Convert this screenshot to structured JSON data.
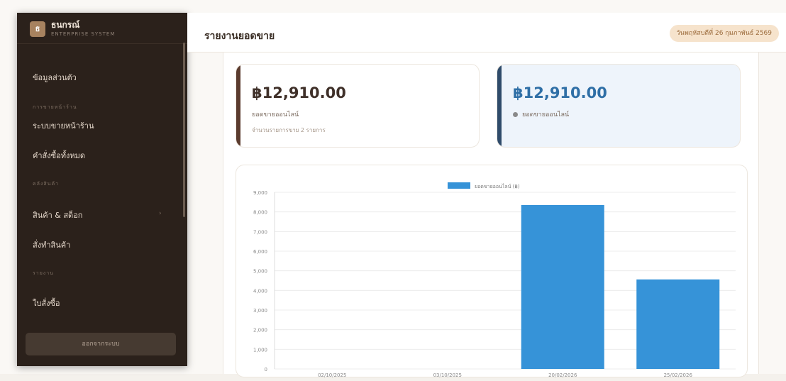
{
  "app": {
    "brand_name": "ธนกรณ์",
    "brand_sub": "ENTERPRISE SYSTEM",
    "logo_letter": "ธ"
  },
  "sidebar": {
    "items": [
      {
        "label": "ข้อมูลส่วนตัว"
      },
      {
        "heading": "การขายหน้าร้าน"
      },
      {
        "label": "ระบบขายหน้าร้าน"
      },
      {
        "label": "คำสั่งซื้อทั้งหมด"
      },
      {
        "heading": "คลังสินค้า"
      },
      {
        "label": "สินค้า & สต็อก"
      },
      {
        "label": "สั่งทำสินค้า"
      },
      {
        "heading": "รายงาน"
      },
      {
        "label": "ใบสั่งซื้อ"
      }
    ],
    "logout_label": "ออกจากระบบ"
  },
  "header": {
    "title": "รายงานยอดขาย",
    "date": "วันพฤหัสบดีที่ 26 กุมภาพันธ์ 2569"
  },
  "cards": [
    {
      "amount": "฿12,910.00",
      "label": "ยอดขายออนไลน์",
      "sub": "จำนวนรายการขาย 2 รายการ"
    },
    {
      "amount": "฿12,910.00",
      "label": "ยอดขายออนไลน์"
    }
  ],
  "colors": {
    "bar": "#3693d8",
    "sidebar_bg": "#2b211b",
    "accent_brown": "#5b3b2e",
    "accent_blue": "#2f6fa6"
  },
  "chart_data": {
    "type": "bar",
    "categories": [
      "02/10/2025",
      "03/10/2025",
      "20/02/2026",
      "25/02/2026"
    ],
    "series": [
      {
        "name": "ยอดขายออนไลน์ (฿)",
        "values": [
          0,
          0,
          8350,
          4560
        ]
      }
    ],
    "ylim": [
      0,
      9000
    ],
    "yticks": [
      "0",
      "1,000",
      "2,000",
      "3,000",
      "4,000",
      "5,000",
      "6,000",
      "7,000",
      "8,000",
      "9,000"
    ],
    "grid": true,
    "legend": "top-center"
  }
}
